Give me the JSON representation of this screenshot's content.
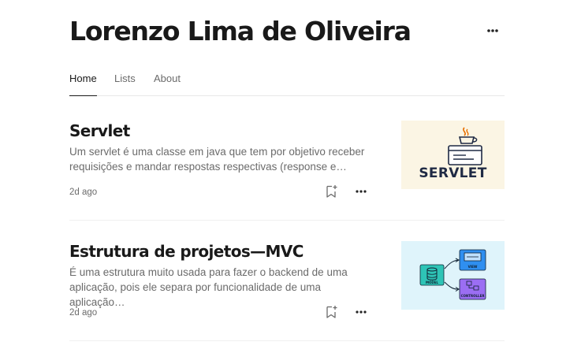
{
  "profile": {
    "name": "Lorenzo Lima de Oliveira"
  },
  "tabs": [
    {
      "label": "Home",
      "active": true
    },
    {
      "label": "Lists",
      "active": false
    },
    {
      "label": "About",
      "active": false
    }
  ],
  "articles": [
    {
      "title": "Servlet",
      "excerpt": "Um servlet é uma classe em java que tem por objetivo receber requisições e mandar respostas respectivas (response e…",
      "date": "2d ago",
      "thumbnail": {
        "label": "SERVLET"
      }
    },
    {
      "title": "Estrutura de projetos—MVC",
      "excerpt": "É uma estrutura muito usada para fazer o backend de uma aplicação, pois ele separa por funcionalidade de uma aplicação…",
      "date": "2d ago",
      "thumbnail": {
        "labels": {
          "model": "MODEL",
          "view": "VIEW",
          "controller": "CONTROLLER"
        }
      }
    }
  ],
  "colors": {
    "text_primary": "#191919",
    "text_secondary": "#6b6b6b",
    "divider": "#e8e8e8",
    "thumb_servlet_bg": "#fbf5e4",
    "thumb_mvc_bg": "#dff4fb",
    "mvc_model": "#2ec4b6",
    "mvc_view": "#2f8ff0",
    "mvc_controller": "#9b6ef3"
  },
  "icons": {
    "header_more": "more-horizontal-icon",
    "bookmark": "bookmark-add-icon",
    "article_more": "more-horizontal-icon",
    "java": "java-cup-icon",
    "database": "database-icon"
  }
}
